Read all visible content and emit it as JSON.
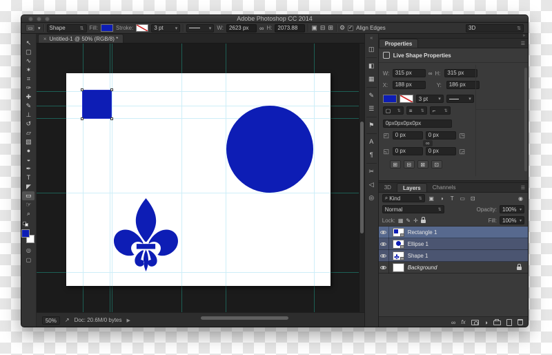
{
  "window": {
    "title": "Adobe Photoshop CC 2014"
  },
  "options_bar": {
    "tool_mode": "Shape",
    "preset_arrow": "▾",
    "fill_label": "Fill:",
    "stroke_label": "Stroke:",
    "stroke_width": "3 pt",
    "w_label": "W:",
    "w_value": "2623 px",
    "link_icon": "∞",
    "h_label": "H:",
    "h_value": "2073.88",
    "path_operations_icon": "▣",
    "path_alignment_icon": "⊟",
    "path_arrangement_icon": "⊞",
    "settings_icon": "⚙",
    "checkmark": "✓",
    "align_edges_label": "Align Edges",
    "workspace": "3D",
    "combo_arrows": "⇅",
    "dropdown_arrow": "▾"
  },
  "document_tab": {
    "close": "×",
    "title": "Untitled-1 @ 50% (RGB/8) *"
  },
  "toolbar": {
    "tools": [
      {
        "name": "move-tool",
        "glyph": "↖"
      },
      {
        "name": "marquee-tool",
        "glyph": "▢"
      },
      {
        "name": "lasso-tool",
        "glyph": "∿"
      },
      {
        "name": "quick-selection-tool",
        "glyph": "✶"
      },
      {
        "name": "crop-tool",
        "glyph": "⌗"
      },
      {
        "name": "eyedropper-tool",
        "glyph": "✑"
      },
      {
        "name": "healing-brush-tool",
        "glyph": "✚"
      },
      {
        "name": "brush-tool",
        "glyph": "✎"
      },
      {
        "name": "clone-stamp-tool",
        "glyph": "⊥"
      },
      {
        "name": "history-brush-tool",
        "glyph": "↺"
      },
      {
        "name": "eraser-tool",
        "glyph": "▱"
      },
      {
        "name": "gradient-tool",
        "glyph": "▧"
      },
      {
        "name": "blur-tool",
        "glyph": "●"
      },
      {
        "name": "dodge-tool",
        "glyph": "◒"
      },
      {
        "name": "pen-tool",
        "glyph": "✒"
      },
      {
        "name": "type-tool",
        "glyph": "T"
      },
      {
        "name": "path-selection-tool",
        "glyph": "◤"
      },
      {
        "name": "rectangle-tool",
        "glyph": "▭"
      },
      {
        "name": "hand-tool",
        "glyph": "☞"
      },
      {
        "name": "zoom-tool",
        "glyph": "⌕"
      }
    ],
    "quick_mask_icon": "◎",
    "screen_mode_icon": "▢"
  },
  "dock": {
    "collapse_icon": "«",
    "icons": [
      {
        "name": "histogram-panel-icon",
        "glyph": "◫"
      },
      {
        "name": "color-panel-icon",
        "glyph": "◧"
      },
      {
        "name": "swatches-panel-icon",
        "glyph": "▦"
      },
      {
        "name": "brush-panel-icon",
        "glyph": "✎"
      },
      {
        "name": "brush-presets-panel-icon",
        "glyph": "☰"
      },
      {
        "name": "layer-comps-panel-icon",
        "glyph": "⚑"
      },
      {
        "name": "character-panel-icon",
        "glyph": "A"
      },
      {
        "name": "paragraph-panel-icon",
        "glyph": "¶"
      },
      {
        "name": "measure-panel-icon",
        "glyph": "✂"
      },
      {
        "name": "notes-panel-icon",
        "glyph": "◁"
      },
      {
        "name": "clone-source-panel-icon",
        "glyph": "◎"
      }
    ]
  },
  "panels": {
    "collapse_icon": "»"
  },
  "properties_panel": {
    "tab": "Properties",
    "menu_icon": "☰",
    "header": "Live Shape Properties",
    "w_label": "W:",
    "w_value": "315 px",
    "h_label": "H:",
    "h_value": "315 px",
    "x_label": "X:",
    "x_value": "188 px",
    "y_label": "Y:",
    "y_value": "186 px",
    "link_icon": "∞",
    "stroke_width": "3 pt",
    "stroke_align_icon": "▢",
    "stroke_caps_icon": "≡",
    "stroke_corners_icon": "⌐",
    "radii_text": "0px0px0px0px",
    "radius_tl": "0 px",
    "radius_tr": "0 px",
    "radius_bl": "0 px",
    "radius_br": "0 px",
    "corner_icon_tl": "◰",
    "corner_icon_tr": "◳",
    "corner_icon_bl": "◱",
    "corner_icon_br": "◲",
    "pathfinder_icons": [
      "⊞",
      "⊟",
      "⊠",
      "⊡"
    ],
    "dropdown_arrow": "▾",
    "combo_arrows": "⇅"
  },
  "layers_panel": {
    "tabs": [
      "3D",
      "Layers",
      "Channels"
    ],
    "menu_icon": "☰",
    "search_icon": "⌕",
    "filter_label": "Kind",
    "filter_icons": [
      "▣",
      "◑",
      "T",
      "▭",
      "⊡"
    ],
    "filter_pin_icon": "◉",
    "blend_mode": "Normal",
    "opacity_label": "Opacity:",
    "opacity_value": "100%",
    "lock_label": "Lock:",
    "lock_icons": [
      "▦",
      "✎",
      "✛"
    ],
    "fill_label": "Fill:",
    "fill_value": "100%",
    "rows": [
      {
        "name": "Rectangle 1"
      },
      {
        "name": "Ellipse 1"
      },
      {
        "name": "Shape 1"
      },
      {
        "name": "Background"
      }
    ],
    "link_icon": "∞",
    "fx_icon": "fx",
    "adjustment_icon": "◑",
    "dropdown_arrow": "▾",
    "combo_arrows": "⇅"
  },
  "status_bar": {
    "zoom": "50%",
    "export_icon": "↗",
    "doc_info": "Doc: 20.6M/0 bytes",
    "expand_icon": "▶"
  },
  "canvas": {
    "shapes": [
      "rectangle",
      "ellipse",
      "fleur-de-lis"
    ]
  },
  "colors": {
    "shape_blue": "#0d1db5",
    "guide_canvas": "#cdeef8",
    "guide_pasteboard": "#1d5f55",
    "layer_selected_active": "#57698e",
    "layer_selected": "#4b5571",
    "panel_bg": "#3a3a3a",
    "pasteboard_bg": "#1b1b1b"
  }
}
